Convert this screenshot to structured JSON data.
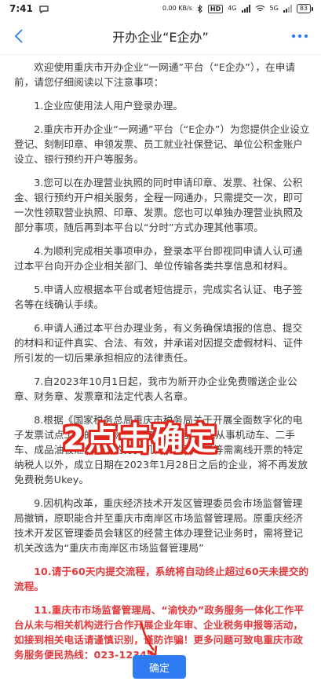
{
  "status_bar": {
    "time": "7:41",
    "speed": "0.00 KB/s",
    "hd": "HD",
    "net1": "4G",
    "net2": "5G",
    "battery": "83"
  },
  "nav": {
    "title": "开办企业“E企办”"
  },
  "paragraphs": [
    {
      "text": "欢迎使用重庆市开办企业“一网通”平台（“E企办”），在申请前，请您仔细阅读以下注意事项：",
      "red": false
    },
    {
      "text": "1.企业应使用法人用户登录办理。",
      "red": false
    },
    {
      "text": "2.重庆市开办企业“一网通”平台（“E企办”）为您提供企业设立登记、刻制印章、申领发票、员工就业社保登记、单位公积金账户设立、银行预约开户等服务。",
      "red": false
    },
    {
      "text": "3.您可以在办理营业执照的同时申请印章、发票、社保、公积金、银行预约开户相关服务，全程一网通办，只需提交一次，即可一次性领取营业执照、印章、发票。您也可以单独办理营业执照及部分事项，随后再到本平台以“分时”方式办理其他事项。",
      "red": false
    },
    {
      "text": "4.为顺利完成相关事项申办，登录本平台即视同申请人认可通过本平台向开办企业相关部门、单位传输各类共享信息和材料。",
      "red": false
    },
    {
      "text": "5.申请人应根据本平台或者短信提示，完成实名认证、电子签名等在线确认手续。",
      "red": false
    },
    {
      "text": "6.申请人通过本平台办理业务，有义务确保填报的信息、提交的材料和证件真实、合法、有效，并承诺对因提交虚假材料、证件所引发的一切后果承担相应的法律责任。",
      "red": false
    },
    {
      "text": "7.自2023年10月1日起，我市为新开办企业免费赠送企业公章、财务章、发票章和法定代表人名章。",
      "red": false
    },
    {
      "text": "8.根据《国家税务总局重庆市税务局关于开展全面数字化的电子发票试点工作的公告》（2023年第1号），除从事机动车、二手车、成品油被汇总纳税的分支机构，以及军工等需离线开票的特定纳税人以外，成立日期在2023年1月28日之后的企业，将不再发放免费税务Ukey。",
      "red": false
    },
    {
      "text": "9.因机构改革，重庆经济技术开发区管理委员会市场监督管理局撤销，原职能合并至重庆市南岸区市场监督管理局。原重庆经济技术开发区管理委员会辖区的经营主体办理登记业务时，需将登记机关改选为“重庆市南岸区市场监督管理局”",
      "red": false
    },
    {
      "text": "10.请于60天内提交流程，系统将自动终止超过60天未提交的流程。",
      "red": true
    },
    {
      "text": "11.重庆市市场监督管理局、“渝快办”政务服务一体化工作平台从未与相关机构进行合作开展企业年审、企业税务申报等活动，如接到相关电话请谨慎识别，谨防诈骗！更多问题可致电重庆市政务服务便民热线：023-12345。",
      "red": true
    }
  ],
  "overlay": {
    "instruction": "2点击确定"
  },
  "footer": {
    "confirm_label": "确定"
  },
  "colors": {
    "accent": "#2f7bf2",
    "warning": "#e4393c",
    "overlay": "#e0251b"
  },
  "icons": [
    "back-icon",
    "more-icon",
    "arrow-icon"
  ]
}
